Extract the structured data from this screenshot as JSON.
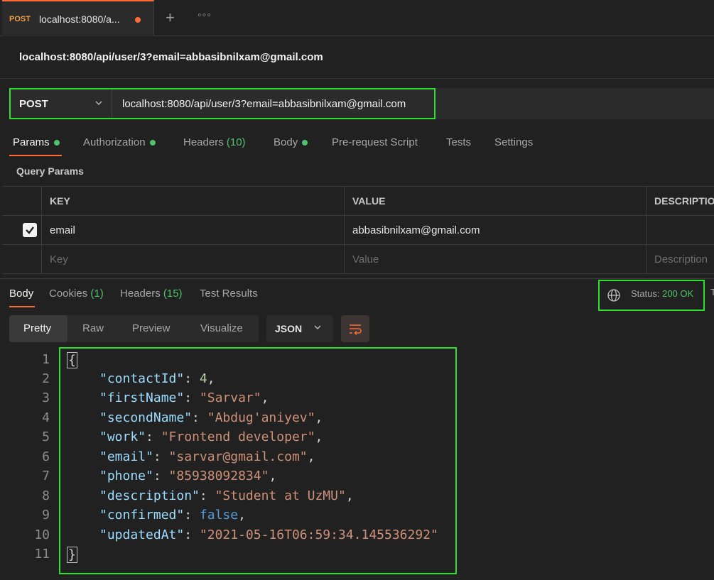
{
  "tab": {
    "method": "POST",
    "title": "localhost:8080/a...",
    "add_icon": "plus-icon",
    "more_icon": "more-icon"
  },
  "request": {
    "title": "localhost:8080/api/user/3?email=abbasibnilxam@gmail.com",
    "method": "POST",
    "url": "localhost:8080/api/user/3?email=abbasibnilxam@gmail.com"
  },
  "request_tabs": {
    "params": "Params",
    "authorization": "Authorization",
    "headers": "Headers",
    "headers_count": "(10)",
    "body": "Body",
    "prerequest": "Pre-request Script",
    "tests": "Tests",
    "settings": "Settings"
  },
  "query_params": {
    "label": "Query Params",
    "columns": [
      "KEY",
      "VALUE",
      "DESCRIPTION"
    ],
    "rows": [
      {
        "key": "email",
        "value": "abbasibnilxam@gmail.com",
        "checked": true
      }
    ],
    "placeholders": {
      "key": "Key",
      "value": "Value",
      "description": "Description"
    }
  },
  "response_tabs": {
    "body": "Body",
    "cookies": "Cookies",
    "cookies_count": "(1)",
    "headers": "Headers",
    "headers_count": "(15)",
    "test_results": "Test Results"
  },
  "status": {
    "label": "Status:",
    "value": "200 OK",
    "trailing": "T"
  },
  "format": {
    "modes": [
      "Pretty",
      "Raw",
      "Preview",
      "Visualize"
    ],
    "active": "Pretty",
    "language": "JSON"
  },
  "code_lines": {
    "open": "{",
    "contactId_key": "\"contactId\"",
    "contactId_val": "4",
    "firstName_key": "\"firstName\"",
    "firstName_val": "\"Sarvar\"",
    "secondName_key": "\"secondName\"",
    "secondName_val": "\"Abdug'aniyev\"",
    "work_key": "\"work\"",
    "work_val": "\"Frontend developer\"",
    "email_key": "\"email\"",
    "email_val": "\"sarvar@gmail.com\"",
    "phone_key": "\"phone\"",
    "phone_val": "\"85938092834\"",
    "description_key": "\"description\"",
    "description_val": "\"Student at UzMU\"",
    "confirmed_key": "\"confirmed\"",
    "confirmed_val": "false",
    "updatedAt_key": "\"updatedAt\"",
    "updatedAt_val": "\"2021-05-16T06:59:34.145536292\"",
    "close": "}"
  },
  "line_numbers": [
    "1",
    "2",
    "3",
    "4",
    "5",
    "6",
    "7",
    "8",
    "9",
    "10",
    "11"
  ],
  "colors": {
    "accent": "#ff6c37",
    "success": "#4fc36b",
    "highlight": "#2ee02e"
  }
}
